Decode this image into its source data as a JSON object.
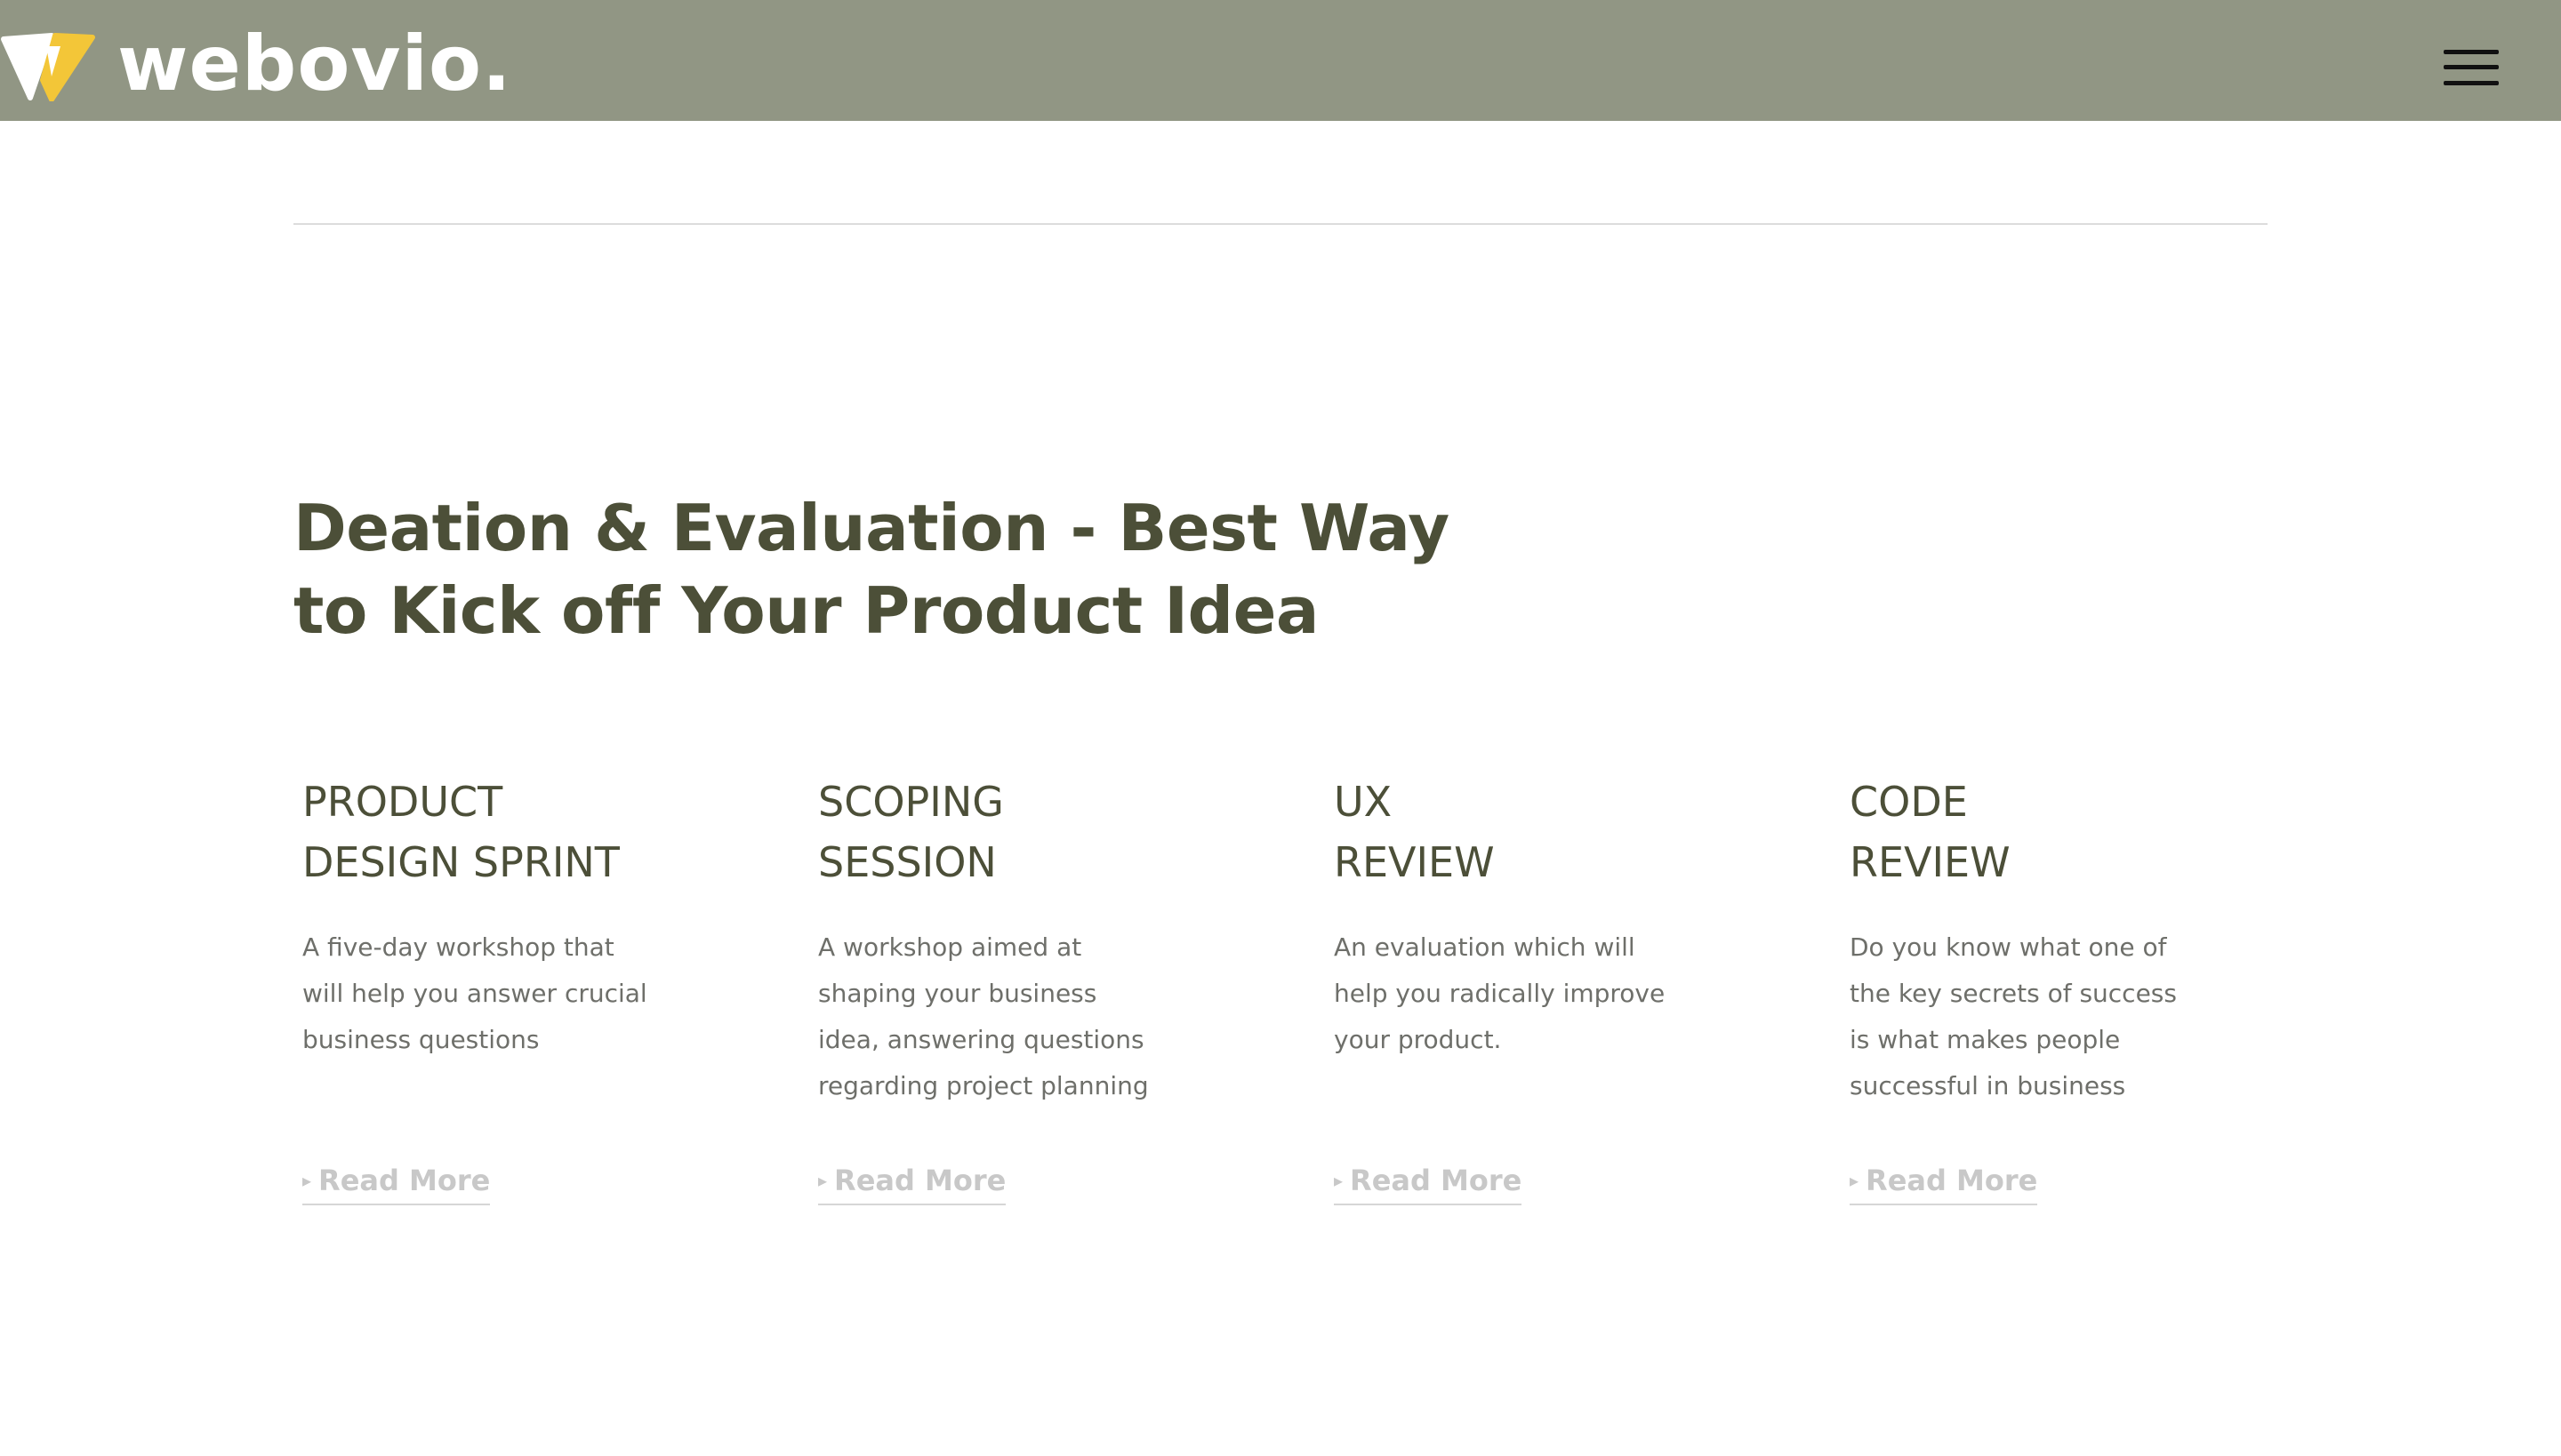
{
  "header": {
    "brand": "webovio.",
    "brand_colors": {
      "mark_white": "#ffffff",
      "mark_yellow": "#f3c638",
      "bar": "#919684"
    },
    "menu_icon": "hamburger-menu-icon"
  },
  "main": {
    "headline_line1": "Deation & Evaluation - Best Way",
    "headline_line2": "to Kick off Your Product Idea",
    "cards": [
      {
        "title": "PRODUCT\nDESIGN SPRINT",
        "description": "A five-day workshop that\nwill help you answer crucial\nbusiness questions",
        "link": "Read More"
      },
      {
        "title": "SCOPING\nSESSION",
        "description": "A workshop aimed at\nshaping your business\nidea, answering questions\nregarding project planning",
        "link": "Read More"
      },
      {
        "title": "UX\nREVIEW",
        "description": "An evaluation which will\nhelp you radically improve\nyour product.",
        "link": "Read More"
      },
      {
        "title": "CODE\nREVIEW",
        "description": "Do you know what one of\nthe key secrets of success\nis what makes people\nsuccessful in business",
        "link": "Read More"
      }
    ]
  },
  "colors": {
    "headline": "#4c4f38",
    "body_text": "#6e6f6a",
    "link": "#c8c8c8"
  }
}
